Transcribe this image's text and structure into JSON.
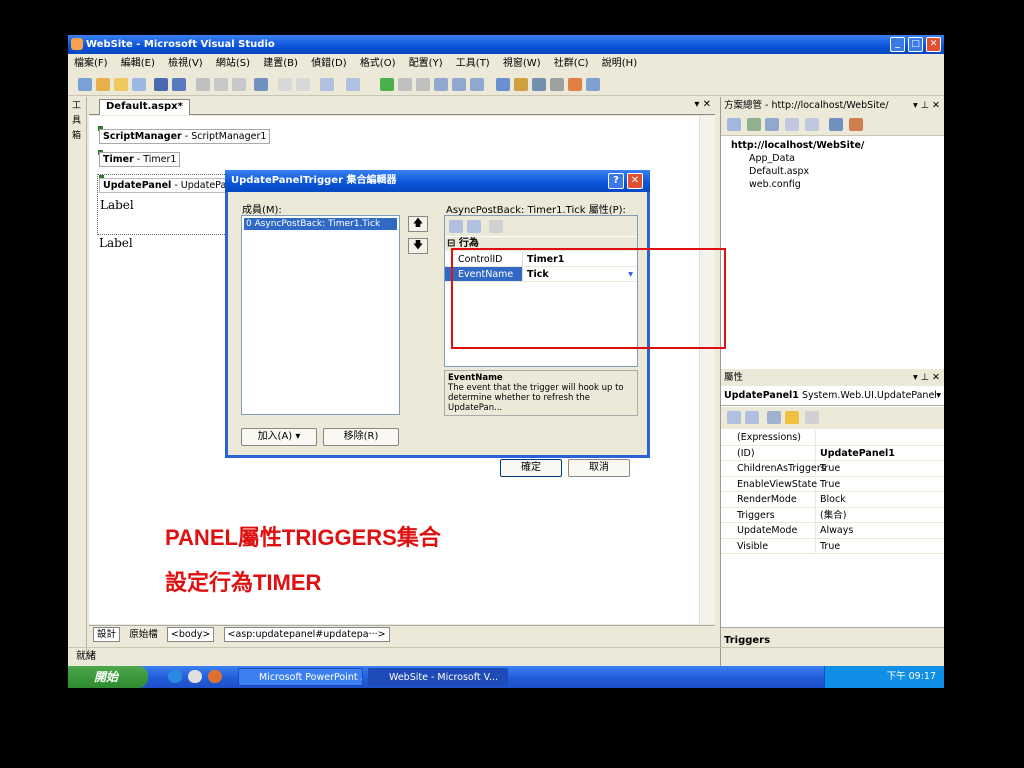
{
  "window": {
    "title": "WebSite - Microsoft Visual Studio",
    "controls": {
      "min": "_",
      "max": "□",
      "close": "✕"
    }
  },
  "menu": [
    "檔案(F)",
    "編輯(E)",
    "檢視(V)",
    "網站(S)",
    "建置(B)",
    "偵錯(D)",
    "格式(O)",
    "配置(Y)",
    "工具(T)",
    "視窗(W)",
    "社群(C)",
    "說明(H)"
  ],
  "sidetab": [
    "工",
    "具",
    "箱"
  ],
  "document": {
    "tab": "Default.aspx*",
    "controls": "▾ ✕",
    "scriptmanager": {
      "name": "ScriptManager",
      "id": " - ScriptManager1"
    },
    "timer": {
      "name": "Timer",
      "id": " - Timer1"
    },
    "updatepanel": {
      "name": "UpdatePanel",
      "id": " - UpdatePanel1"
    },
    "label_inside": "Label",
    "label_outside": "Label"
  },
  "bottombar": {
    "design": "設計",
    "source": "原始檔",
    "tag_body": "<body>",
    "tag_up": "<asp:updatepanel#updatepa···>"
  },
  "solution": {
    "title": "方案總管 - http://localhost/WebSite/",
    "pane_ctl": "▾ ⊥ ✕",
    "root": "http://localhost/WebSite/",
    "items": [
      "App_Data",
      "Default.aspx",
      "web.config"
    ]
  },
  "properties": {
    "title": "屬性",
    "pane_ctl": "▾ ⊥ ✕",
    "object": "UpdatePanel1",
    "object_type": "System.Web.UI.UpdatePanel",
    "rows": [
      {
        "k": "(Expressions)",
        "v": ""
      },
      {
        "k": "(ID)",
        "v": "UpdatePanel1"
      },
      {
        "k": "ChildrenAsTriggers",
        "v": "True"
      },
      {
        "k": "EnableViewState",
        "v": "True"
      },
      {
        "k": "RenderMode",
        "v": "Block"
      },
      {
        "k": "Triggers",
        "v": "(集合)"
      },
      {
        "k": "UpdateMode",
        "v": "Always"
      },
      {
        "k": "Visible",
        "v": "True"
      }
    ],
    "desc_title": "Triggers"
  },
  "dialog": {
    "title": "UpdatePanelTrigger 集合編輯器",
    "members_label": "成員(M):",
    "member_item": "0  AsyncPostBack: Timer1.Tick",
    "props_label": "AsyncPostBack: Timer1.Tick 屬性(P):",
    "category": "行為",
    "rows": [
      {
        "k": "ControlID",
        "v": "Timer1"
      },
      {
        "k": "EventName",
        "v": "Tick"
      }
    ],
    "desc_title": "EventName",
    "desc_text": "The event that the trigger will hook up to determine whether to refresh the UpdatePan...",
    "add": "加入(A)",
    "remove": "移除(R)",
    "ok": "確定",
    "cancel": "取消"
  },
  "status": "就緒",
  "taskbar": {
    "start": "開始",
    "tasks": [
      "Microsoft PowerPoint ...",
      "WebSite - Microsoft V..."
    ],
    "time": "下午 09:17"
  },
  "annotation": {
    "line1": "PANEL屬性TRIGGERS集合",
    "line2": "設定行為TIMER"
  },
  "colors": {
    "annotation": "#e01010",
    "titlebar": "#0a53d8",
    "selection": "#316ac5"
  }
}
